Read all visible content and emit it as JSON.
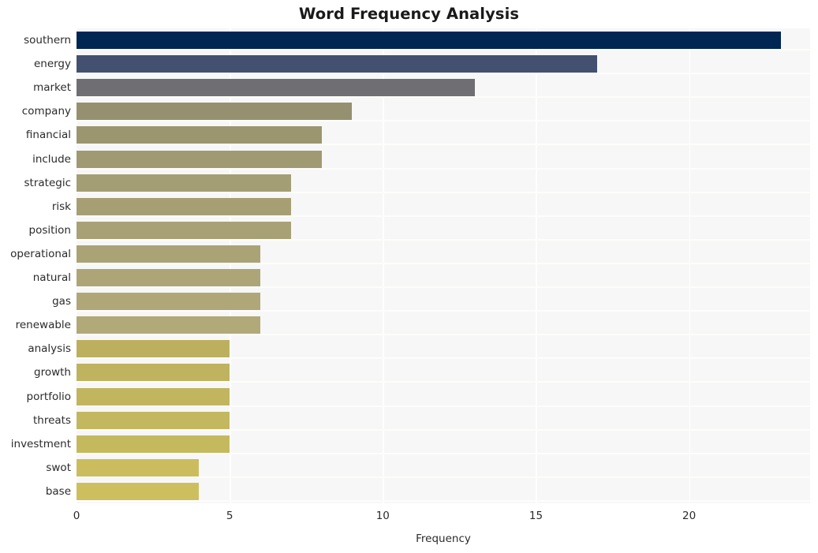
{
  "chart_data": {
    "type": "bar",
    "orientation": "horizontal",
    "title": "Word Frequency Analysis",
    "xlabel": "Frequency",
    "ylabel": "",
    "xlim": [
      0,
      23.95
    ],
    "xticks": [
      0,
      5,
      10,
      15,
      20
    ],
    "xtick_labels": [
      "0",
      "5",
      "10",
      "15",
      "20"
    ],
    "grid": "vertical-only",
    "legend": "none",
    "categories": [
      "southern",
      "energy",
      "market",
      "company",
      "financial",
      "include",
      "strategic",
      "risk",
      "position",
      "operational",
      "natural",
      "gas",
      "renewable",
      "analysis",
      "growth",
      "portfolio",
      "threats",
      "investment",
      "swot",
      "base"
    ],
    "values": [
      23,
      17,
      13,
      9,
      8,
      8,
      7,
      7,
      7,
      6,
      6,
      6,
      6,
      5,
      5,
      5,
      5,
      5,
      4,
      4
    ],
    "bar_colors": [
      "#002654",
      "#435070",
      "#6e6e73",
      "#95906f",
      "#9c9670",
      "#a09a72",
      "#a49e74",
      "#a69f74",
      "#a8a175",
      "#aaa376",
      "#ada577",
      "#afa778",
      "#b1a978",
      "#bcb05f",
      "#bfb35f",
      "#c1b55f",
      "#c3b75f",
      "#c5b95e",
      "#cbbd5d",
      "#cdbf5d"
    ],
    "plot_background": "#f7f7f7",
    "gridline_color": "#ffffff",
    "title_color": "#1a1a1a"
  }
}
